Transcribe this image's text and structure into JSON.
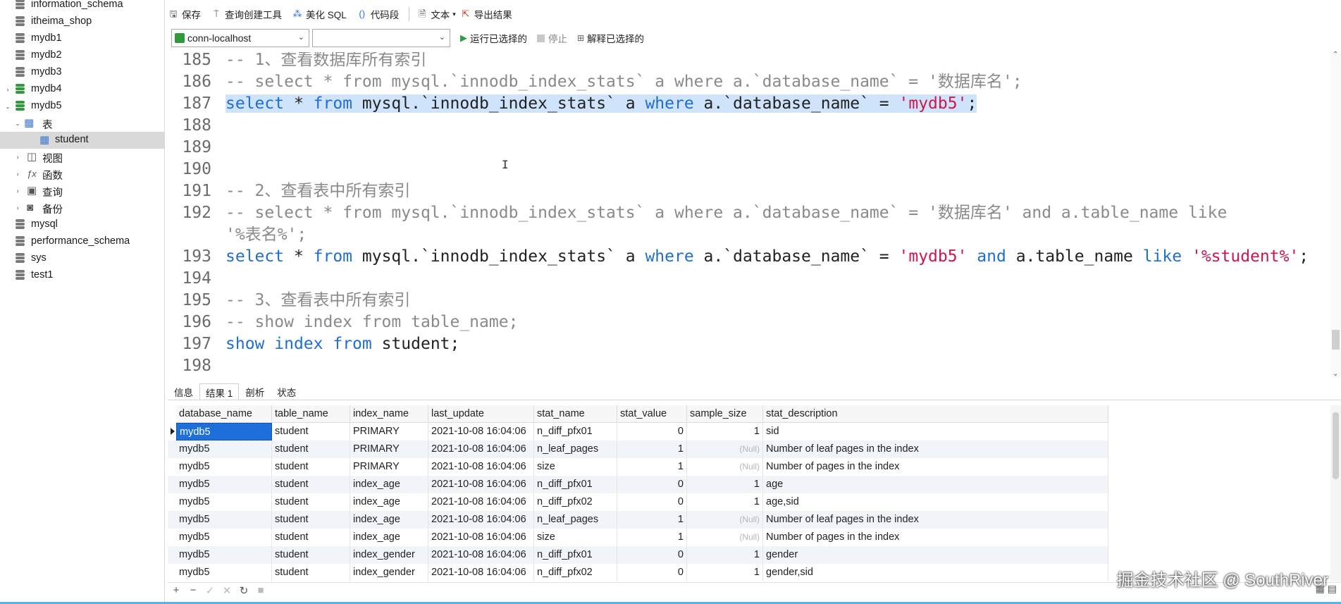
{
  "sidebar": {
    "items": [
      {
        "label": "information_schema",
        "type": "db",
        "open": false,
        "twisty": ""
      },
      {
        "label": "itheima_shop",
        "type": "db",
        "open": false,
        "twisty": ""
      },
      {
        "label": "mydb1",
        "type": "db",
        "open": false,
        "twisty": ""
      },
      {
        "label": "mydb2",
        "type": "db",
        "open": false,
        "twisty": ""
      },
      {
        "label": "mydb3",
        "type": "db",
        "open": false,
        "twisty": ""
      },
      {
        "label": "mydb4",
        "type": "db",
        "open": true,
        "twisty": "›"
      },
      {
        "label": "mydb5",
        "type": "db",
        "open": true,
        "twisty": "⌄"
      },
      {
        "label": "表",
        "type": "tables",
        "twisty": "⌄"
      },
      {
        "label": "student",
        "type": "table",
        "selected": true
      },
      {
        "label": "视图",
        "type": "views",
        "twisty": "›"
      },
      {
        "label": "函数",
        "type": "functions",
        "twisty": "›"
      },
      {
        "label": "查询",
        "type": "queries",
        "twisty": "›"
      },
      {
        "label": "备份",
        "type": "backups",
        "twisty": "›"
      },
      {
        "label": "mysql",
        "type": "db",
        "open": false,
        "twisty": ""
      },
      {
        "label": "performance_schema",
        "type": "db",
        "open": false,
        "twisty": ""
      },
      {
        "label": "sys",
        "type": "db",
        "open": false,
        "twisty": ""
      },
      {
        "label": "test1",
        "type": "db",
        "open": false,
        "twisty": ""
      }
    ]
  },
  "toolbar": {
    "save": "保存",
    "query_builder": "查询创建工具",
    "beautify": "美化 SQL",
    "snippet": "代码段",
    "text": "文本",
    "export": "导出结果"
  },
  "toolbar2": {
    "connection": "conn-localhost",
    "database": "",
    "run_selected": "运行已选择的",
    "stop": "停止",
    "explain_selected": "解释已选择的"
  },
  "editor": {
    "lines": [
      {
        "n": "185",
        "html": "<span class='cmt'>-- 1、查看数据库所有索引</span>"
      },
      {
        "n": "186",
        "html": "<span class='cmt'>-- select * from mysql.`innodb_index_stats` a where a.`database_name` = '数据库名';</span>"
      },
      {
        "n": "187",
        "html": "<span class='hl'><span class='kw'>select</span> * <span class='kw'>from</span> mysql.`innodb_index_stats` a <span class='kw'>where</span> a.`database_name` = <span class='str'>'mydb5'</span>;</span>"
      },
      {
        "n": "188",
        "html": ""
      },
      {
        "n": "189",
        "html": ""
      },
      {
        "n": "190",
        "html": ""
      },
      {
        "n": "191",
        "html": "<span class='cmt'>-- 2、查看表中所有索引</span>"
      },
      {
        "n": "192",
        "html": "<span class='cmt'>-- select * from mysql.`innodb_index_stats` a where a.`database_name` = '数据库名' and a.table_name like</span>"
      },
      {
        "n": "",
        "html": "<span class='cmt'>'%表名%';</span>"
      },
      {
        "n": "193",
        "html": "<span class='kw'>select</span> * <span class='kw'>from</span> mysql.`innodb_index_stats` a <span class='kw'>where</span> a.`database_name` = <span class='str'>'mydb5'</span> <span class='kw'>and</span> a.table_name <span class='kw'>like</span> <span class='str'>'%student%'</span>;"
      },
      {
        "n": "194",
        "html": ""
      },
      {
        "n": "195",
        "html": "<span class='cmt'>-- 3、查看表中所有索引</span>"
      },
      {
        "n": "196",
        "html": "<span class='cmt'>-- show index from table_name;</span>"
      },
      {
        "n": "197",
        "html": "<span class='kw'>show</span> <span class='kw'>index</span> <span class='kw'>from</span> student;"
      },
      {
        "n": "198",
        "html": ""
      }
    ]
  },
  "result_tabs": [
    "信息",
    "结果 1",
    "剖析",
    "状态"
  ],
  "grid": {
    "columns": [
      "database_name",
      "table_name",
      "index_name",
      "last_update",
      "stat_name",
      "stat_value",
      "sample_size",
      "stat_description"
    ],
    "rows": [
      [
        "mydb5",
        "student",
        "PRIMARY",
        "2021-10-08 16:04:06",
        "n_diff_pfx01",
        "0",
        "1",
        "sid"
      ],
      [
        "mydb5",
        "student",
        "PRIMARY",
        "2021-10-08 16:04:06",
        "n_leaf_pages",
        "1",
        "(Null)",
        "Number of leaf pages in the index"
      ],
      [
        "mydb5",
        "student",
        "PRIMARY",
        "2021-10-08 16:04:06",
        "size",
        "1",
        "(Null)",
        "Number of pages in the index"
      ],
      [
        "mydb5",
        "student",
        "index_age",
        "2021-10-08 16:04:06",
        "n_diff_pfx01",
        "0",
        "1",
        "age"
      ],
      [
        "mydb5",
        "student",
        "index_age",
        "2021-10-08 16:04:06",
        "n_diff_pfx02",
        "0",
        "1",
        "age,sid"
      ],
      [
        "mydb5",
        "student",
        "index_age",
        "2021-10-08 16:04:06",
        "n_leaf_pages",
        "1",
        "(Null)",
        "Number of leaf pages in the index"
      ],
      [
        "mydb5",
        "student",
        "index_age",
        "2021-10-08 16:04:06",
        "size",
        "1",
        "(Null)",
        "Number of pages in the index"
      ],
      [
        "mydb5",
        "student",
        "index_gender",
        "2021-10-08 16:04:06",
        "n_diff_pfx01",
        "0",
        "1",
        "gender"
      ],
      [
        "mydb5",
        "student",
        "index_gender",
        "2021-10-08 16:04:06",
        "n_diff_pfx02",
        "0",
        "1",
        "gender,sid"
      ]
    ]
  },
  "bottom_toolbar": [
    "+",
    "−",
    "✓",
    "✕",
    "↻",
    "■"
  ],
  "watermark": "掘金技术社区 @ SouthRiver",
  "colors": {
    "keyword": "#1f6fd0",
    "string": "#d0154d",
    "comment": "#8a8a8a",
    "selection": "#cfe3fa",
    "db_open": "#2e9a3c"
  }
}
